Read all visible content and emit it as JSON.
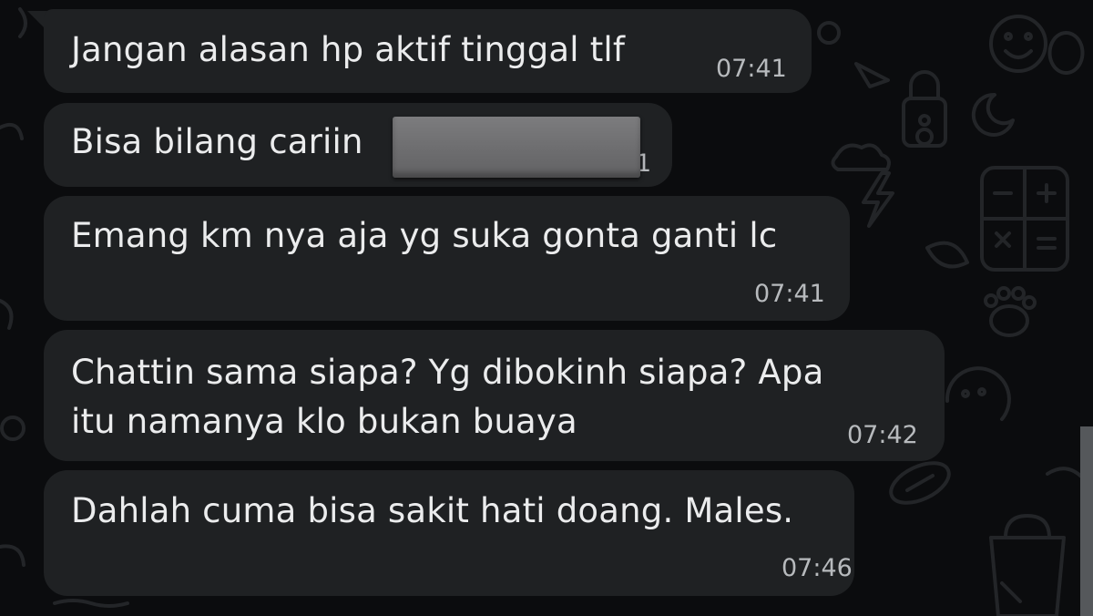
{
  "messages": [
    {
      "text": "Jangan alasan hp aktif tinggal tlf",
      "time": "07:41"
    },
    {
      "text": "Bisa bilang cariin",
      "time_visible_fragment": "1"
    },
    {
      "text": "Emang km nya aja yg suka gonta ganti lc",
      "time": "07:41"
    },
    {
      "text_line1": "Chattin sama siapa? Yg dibokinh siapa? Apa",
      "text_line2": "itu namanya klo bukan buaya",
      "time": "07:42"
    },
    {
      "text": "Dahlah cuma bisa sakit hati doang. Males.",
      "time": "07:46"
    }
  ],
  "colors": {
    "background": "#0b0c0e",
    "bubble": "#1f2123",
    "text": "#ebeced",
    "timestamp": "#b7babd",
    "redaction": "#6f6f71"
  }
}
